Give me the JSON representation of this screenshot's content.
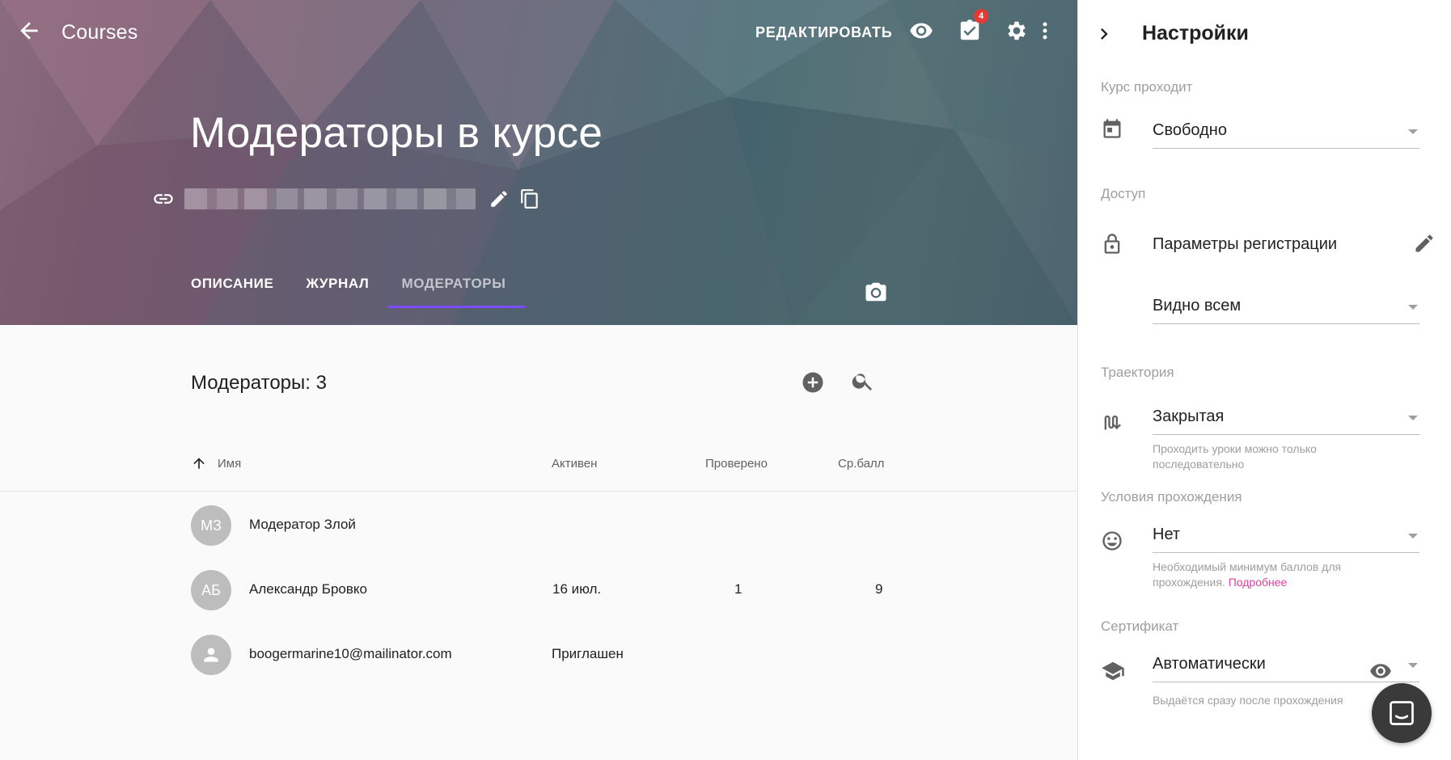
{
  "toolbar": {
    "title": "Courses",
    "edit_label": "РЕДАКТИРОВАТЬ",
    "tasks_badge": "4"
  },
  "course": {
    "title": "Модераторы в курсе"
  },
  "tabs": [
    {
      "label": "ОПИСАНИЕ",
      "active": false
    },
    {
      "label": "ЖУРНАЛ",
      "active": false
    },
    {
      "label": "МОДЕРАТОРЫ",
      "active": true
    }
  ],
  "moderators": {
    "heading": "Модераторы: 3",
    "columns": {
      "name": "Имя",
      "active": "Активен",
      "checked": "Проверено",
      "avg": "Ср.балл"
    },
    "rows": [
      {
        "initials": "МЗ",
        "name": "Модератор Злой",
        "active": "",
        "checked": "",
        "avg": ""
      },
      {
        "initials": "АБ",
        "name": "Александр Бровко",
        "active": "16 июл.",
        "checked": "1",
        "avg": "9"
      },
      {
        "initials": "",
        "name": "boogermarine10@mailinator.com",
        "active": "Приглашен",
        "checked": "",
        "avg": ""
      }
    ]
  },
  "settings": {
    "title": "Настройки",
    "course_mode_label": "Курс проходит",
    "course_mode_value": "Свободно",
    "access_label": "Доступ",
    "registration_label": "Параметры регистрации",
    "visibility_value": "Видно всем",
    "trajectory_label": "Траектория",
    "trajectory_value": "Закрытая",
    "trajectory_hint": "Проходить уроки можно только последовательно",
    "conditions_label": "Условия прохождения",
    "conditions_value": "Нет",
    "conditions_hint": "Необходимый минимум баллов для прохождения.",
    "conditions_link": "Подробнее",
    "certificate_label": "Сертификат",
    "certificate_value": "Автоматически",
    "certificate_hint": "Выдаётся сразу после прохождения"
  },
  "colors": {
    "accent": "#7c4dff",
    "badge": "#e53935",
    "link": "#e040a0"
  }
}
